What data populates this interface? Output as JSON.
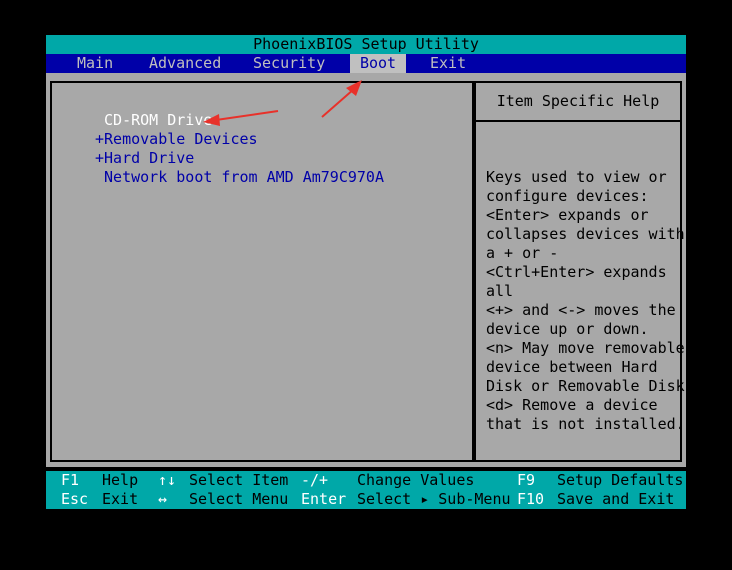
{
  "title": "PhoenixBIOS Setup Utility",
  "menu": [
    {
      "label": "Main",
      "active": false
    },
    {
      "label": "Advanced",
      "active": false
    },
    {
      "label": "Security",
      "active": false
    },
    {
      "label": "Boot",
      "active": true
    },
    {
      "label": "Exit",
      "active": false
    }
  ],
  "boot_order": [
    {
      "label": " CD-ROM Drive",
      "selected": true
    },
    {
      "label": "+Removable Devices",
      "selected": false
    },
    {
      "label": "+Hard Drive",
      "selected": false
    },
    {
      "label": " Network boot from AMD Am79C970A",
      "selected": false
    }
  ],
  "help": {
    "title": "Item Specific Help",
    "lines": [
      "Keys used to view or",
      "configure devices:",
      "<Enter> expands or",
      "collapses devices with",
      "a + or -",
      "<Ctrl+Enter> expands",
      "all",
      "<+> and <-> moves the",
      "device up or down.",
      "<n> May move removable",
      "device between Hard",
      "Disk or Removable Disk",
      "<d> Remove a device",
      "that is not installed."
    ]
  },
  "footer": {
    "row1": [
      {
        "key": "F1",
        "desc": "Help"
      },
      {
        "key": "↑↓",
        "desc": "Select Item"
      },
      {
        "key": "-/+",
        "desc": "Change Values"
      },
      {
        "key": "F9",
        "desc": "Setup Defaults"
      }
    ],
    "row2": [
      {
        "key": "Esc",
        "desc": "Exit"
      },
      {
        "key": "↔",
        "desc": "Select Menu"
      },
      {
        "key": "Enter",
        "desc": "Select ▸ Sub-Menu"
      },
      {
        "key": "F10",
        "desc": "Save and Exit"
      }
    ]
  },
  "colors": {
    "cyan": "#00a8a8",
    "blue": "#0000a8",
    "gray": "#a8a8a8",
    "annotation_red": "#e8312a"
  }
}
